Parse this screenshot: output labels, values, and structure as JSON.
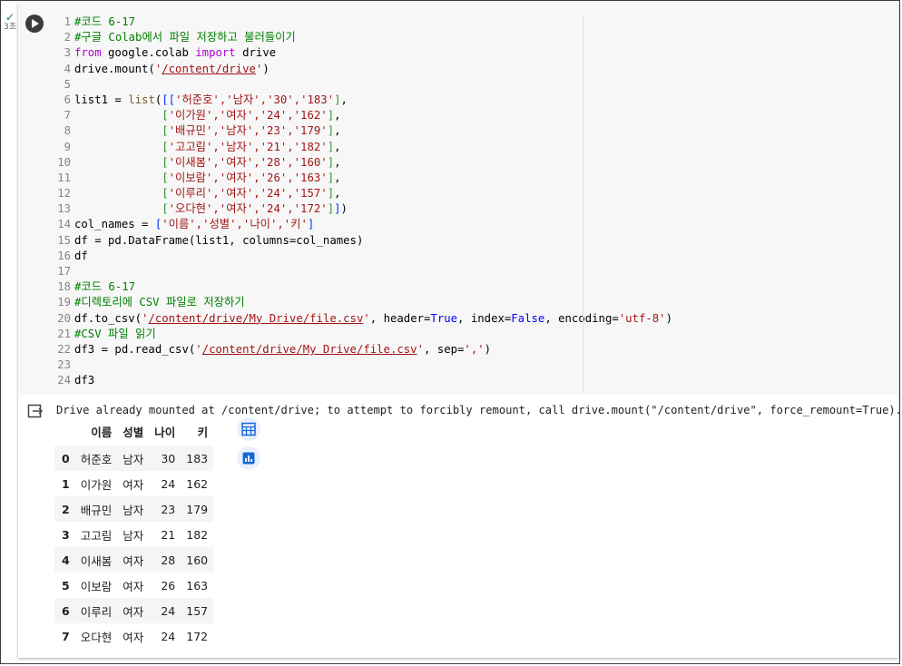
{
  "exec_status": {
    "check_glyph": "✓",
    "time": "3초"
  },
  "code_lines": [
    {
      "n": "1",
      "t": [
        [
          "com",
          "#코드 6-17"
        ]
      ]
    },
    {
      "n": "2",
      "t": [
        [
          "com",
          "#구글 Colab에서 파일 저장하고 불러들이기"
        ]
      ]
    },
    {
      "n": "3",
      "t": [
        [
          "kw",
          "from"
        ],
        [
          "p",
          " google.colab "
        ],
        [
          "kw",
          "import"
        ],
        [
          "p",
          " drive"
        ]
      ]
    },
    {
      "n": "4",
      "t": [
        [
          "p",
          "drive.mount("
        ],
        [
          "str",
          "'"
        ],
        [
          "strl",
          "/content/drive"
        ],
        [
          "str",
          "'"
        ],
        [
          "p",
          ")"
        ]
      ]
    },
    {
      "n": "5",
      "t": []
    },
    {
      "n": "6",
      "t": [
        [
          "p",
          "list1 = "
        ],
        [
          "bi",
          "list"
        ],
        [
          "p",
          "("
        ],
        [
          "brk",
          "[["
        ],
        [
          "str",
          "'허준호','남자','30','183'"
        ],
        [
          "brk2",
          "]"
        ],
        [
          "p",
          ","
        ]
      ]
    },
    {
      "n": "7",
      "t": [
        [
          "p",
          "             "
        ],
        [
          "brk2",
          "["
        ],
        [
          "str",
          "'이가원','여자','24','162'"
        ],
        [
          "brk2",
          "]"
        ],
        [
          "p",
          ","
        ]
      ]
    },
    {
      "n": "8",
      "t": [
        [
          "p",
          "             "
        ],
        [
          "brk2",
          "["
        ],
        [
          "str",
          "'배규민','남자','23','179'"
        ],
        [
          "brk2",
          "]"
        ],
        [
          "p",
          ","
        ]
      ]
    },
    {
      "n": "9",
      "t": [
        [
          "p",
          "             "
        ],
        [
          "brk2",
          "["
        ],
        [
          "str",
          "'고고림','남자','21','182'"
        ],
        [
          "brk2",
          "]"
        ],
        [
          "p",
          ","
        ]
      ]
    },
    {
      "n": "10",
      "t": [
        [
          "p",
          "             "
        ],
        [
          "brk2",
          "["
        ],
        [
          "str",
          "'이새봄','여자','28','160'"
        ],
        [
          "brk2",
          "]"
        ],
        [
          "p",
          ","
        ]
      ]
    },
    {
      "n": "11",
      "t": [
        [
          "p",
          "             "
        ],
        [
          "brk2",
          "["
        ],
        [
          "str",
          "'이보람','여자','26','163'"
        ],
        [
          "brk2",
          "]"
        ],
        [
          "p",
          ","
        ]
      ]
    },
    {
      "n": "12",
      "t": [
        [
          "p",
          "             "
        ],
        [
          "brk2",
          "["
        ],
        [
          "str",
          "'이루리','여자','24','157'"
        ],
        [
          "brk2",
          "]"
        ],
        [
          "p",
          ","
        ]
      ]
    },
    {
      "n": "13",
      "t": [
        [
          "p",
          "             "
        ],
        [
          "brk2",
          "["
        ],
        [
          "str",
          "'오다현','여자','24','172'"
        ],
        [
          "brk2",
          "]"
        ],
        [
          "brk",
          "]"
        ],
        [
          "p",
          ")"
        ]
      ]
    },
    {
      "n": "14",
      "t": [
        [
          "p",
          "col_names = "
        ],
        [
          "brk",
          "["
        ],
        [
          "str",
          "'이름','성별','나이','키'"
        ],
        [
          "brk",
          "]"
        ]
      ]
    },
    {
      "n": "15",
      "t": [
        [
          "p",
          "df = pd.DataFrame(list1, columns=col_names)"
        ]
      ]
    },
    {
      "n": "16",
      "t": [
        [
          "p",
          "df"
        ]
      ]
    },
    {
      "n": "17",
      "t": []
    },
    {
      "n": "18",
      "t": [
        [
          "com",
          "#코드 6-17"
        ]
      ]
    },
    {
      "n": "19",
      "t": [
        [
          "com",
          "#디렉토리에 CSV 파일로 저장하기"
        ]
      ]
    },
    {
      "n": "20",
      "t": [
        [
          "p",
          "df.to_csv("
        ],
        [
          "str",
          "'"
        ],
        [
          "strl",
          "/content/drive/My Drive/file.csv"
        ],
        [
          "str",
          "'"
        ],
        [
          "p",
          ", header="
        ],
        [
          "const",
          "True"
        ],
        [
          "p",
          ", index="
        ],
        [
          "const",
          "False"
        ],
        [
          "p",
          ", encoding="
        ],
        [
          "str",
          "'utf-8'"
        ],
        [
          "p",
          ")"
        ]
      ]
    },
    {
      "n": "21",
      "t": [
        [
          "com",
          "#CSV 파일 읽기"
        ]
      ]
    },
    {
      "n": "22",
      "t": [
        [
          "p",
          "df3 = pd.read_csv("
        ],
        [
          "str",
          "'"
        ],
        [
          "strl",
          "/content/drive/My Drive/file.csv"
        ],
        [
          "str",
          "'"
        ],
        [
          "p",
          ", sep="
        ],
        [
          "str",
          "','"
        ],
        [
          "p",
          ")"
        ]
      ]
    },
    {
      "n": "23",
      "t": []
    },
    {
      "n": "24",
      "t": [
        [
          "p",
          "df3"
        ]
      ]
    }
  ],
  "output": {
    "message": "Drive already mounted at /content/drive; to attempt to forcibly remount, call drive.mount(\"/content/drive\", force_remount=True).",
    "table": {
      "columns": [
        "이름",
        "성별",
        "나이",
        "키"
      ],
      "rows": [
        [
          "0",
          "허준호",
          "남자",
          "30",
          "183"
        ],
        [
          "1",
          "이가원",
          "여자",
          "24",
          "162"
        ],
        [
          "2",
          "배규민",
          "남자",
          "23",
          "179"
        ],
        [
          "3",
          "고고림",
          "남자",
          "21",
          "182"
        ],
        [
          "4",
          "이새봄",
          "여자",
          "28",
          "160"
        ],
        [
          "5",
          "이보람",
          "여자",
          "26",
          "163"
        ],
        [
          "6",
          "이루리",
          "여자",
          "24",
          "157"
        ],
        [
          "7",
          "오다현",
          "여자",
          "24",
          "172"
        ]
      ]
    }
  },
  "icons": {
    "run": "play-icon",
    "output_toggle": "output-arrow-icon",
    "table_view": "table-grid-icon",
    "chart_suggest": "bar-chart-icon"
  },
  "colors": {
    "accent": "#1967d2",
    "comment": "#008000",
    "keyword": "#af00db",
    "string": "#a31515"
  }
}
